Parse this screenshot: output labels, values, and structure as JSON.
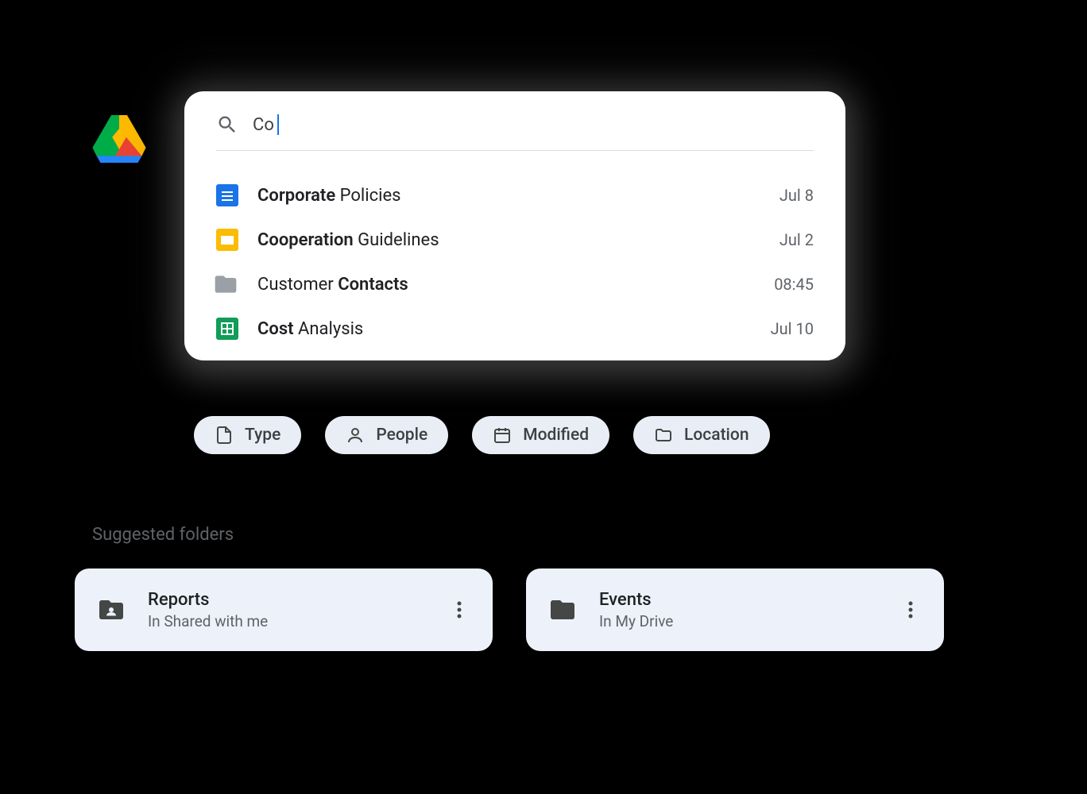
{
  "search": {
    "query": "Co"
  },
  "results": [
    {
      "title_bold": "Corporate",
      "title_rest": " Policies",
      "time": "Jul 8",
      "icon": "docs"
    },
    {
      "title_bold": "Cooperation",
      "title_rest": " Guidelines",
      "time": "Jul 2",
      "icon": "slides"
    },
    {
      "title_prefix": "Customer ",
      "title_bold": "Contacts",
      "time": "08:45",
      "icon": "folder"
    },
    {
      "title_bold": "Cost",
      "title_rest": " Analysis",
      "time": "Jul 10",
      "icon": "sheets"
    }
  ],
  "chips": [
    {
      "label": "Type",
      "icon": "file"
    },
    {
      "label": "People",
      "icon": "person"
    },
    {
      "label": "Modified",
      "icon": "calendar"
    },
    {
      "label": "Location",
      "icon": "folder"
    }
  ],
  "suggested": {
    "heading": "Suggested folders",
    "folders": [
      {
        "name": "Reports",
        "location": "In Shared with me",
        "icon": "shared-folder"
      },
      {
        "name": "Events",
        "location": "In My Drive",
        "icon": "folder"
      }
    ]
  }
}
